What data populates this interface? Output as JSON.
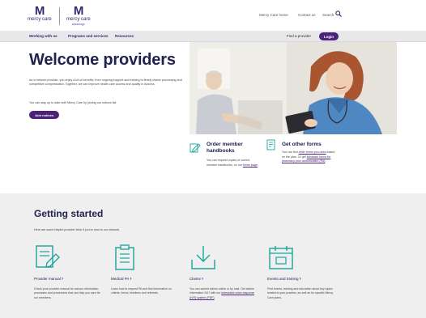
{
  "header": {
    "logo_primary": {
      "mark": "M",
      "word": "mercy care",
      "sub": ""
    },
    "logo_secondary": {
      "mark": "M",
      "word": "mercy care",
      "sub": "advantage"
    },
    "utility_links": [
      "Mercy Care home",
      "Contact us",
      "Search"
    ]
  },
  "nav": {
    "items": [
      "Working with us",
      "Programs and services",
      "Resources"
    ],
    "find_provider": "Find a provider",
    "login": "Login"
  },
  "hero": {
    "title": "Welcome providers",
    "paragraph_1": "As a network provider, you enjoy a lot of benefits, from ongoing support and training to timely claims processing and competitive compensation. Together, we can improve health care access and quality in Arizona.",
    "paragraph_2": "You can stay up to date with Mercy Care by joining our notices list.",
    "join_button": "Join notices"
  },
  "cards": [
    {
      "title": "Order member handbooks",
      "text_before": "You can request copies of current member handbooks, on our ",
      "link_1": "forms page",
      "text_after": "."
    },
    {
      "title": "Get other forms",
      "text_before": "You can find ",
      "link_1": "other forms you need",
      "text_middle": " based on the plan. Or get ",
      "link_2": "Medicaid forms for pharmacy prior authorization (PA)",
      "text_after": "."
    }
  ],
  "getting_started": {
    "title": "Getting started",
    "intro": "Here are some helpful provider links if you're new to our network.",
    "items": [
      {
        "label": "Provider manual",
        "text": "Check your provider manual for various information, processes and procedures that can help you care for our members."
      },
      {
        "label": "Medical PA",
        "text": "Learn how to request PA and find information on criteria, forms, timelines and referrals."
      },
      {
        "label": "Claims",
        "text_before": "You can submit claims online or by mail. Get claims information 24/7 with our ",
        "link": "Interactive voice response (IVR) system (PDF)",
        "text_after": "."
      },
      {
        "label": "Events and training",
        "text": "Find events, training and education about key topics related to your practice, as well as for specific Mercy Care plans."
      }
    ]
  },
  "colors": {
    "brand_navy": "#22224f",
    "brand_purple": "#4a2378",
    "accent_teal": "#1aa39a",
    "nav_bg": "#e8e8ea",
    "section_bg": "#efefef"
  },
  "icons": [
    "search-icon",
    "handbook-icon",
    "forms-icon",
    "provider-manual-icon",
    "clipboard-icon",
    "download-icon",
    "calendar-icon",
    "chevron-right-icon"
  ]
}
